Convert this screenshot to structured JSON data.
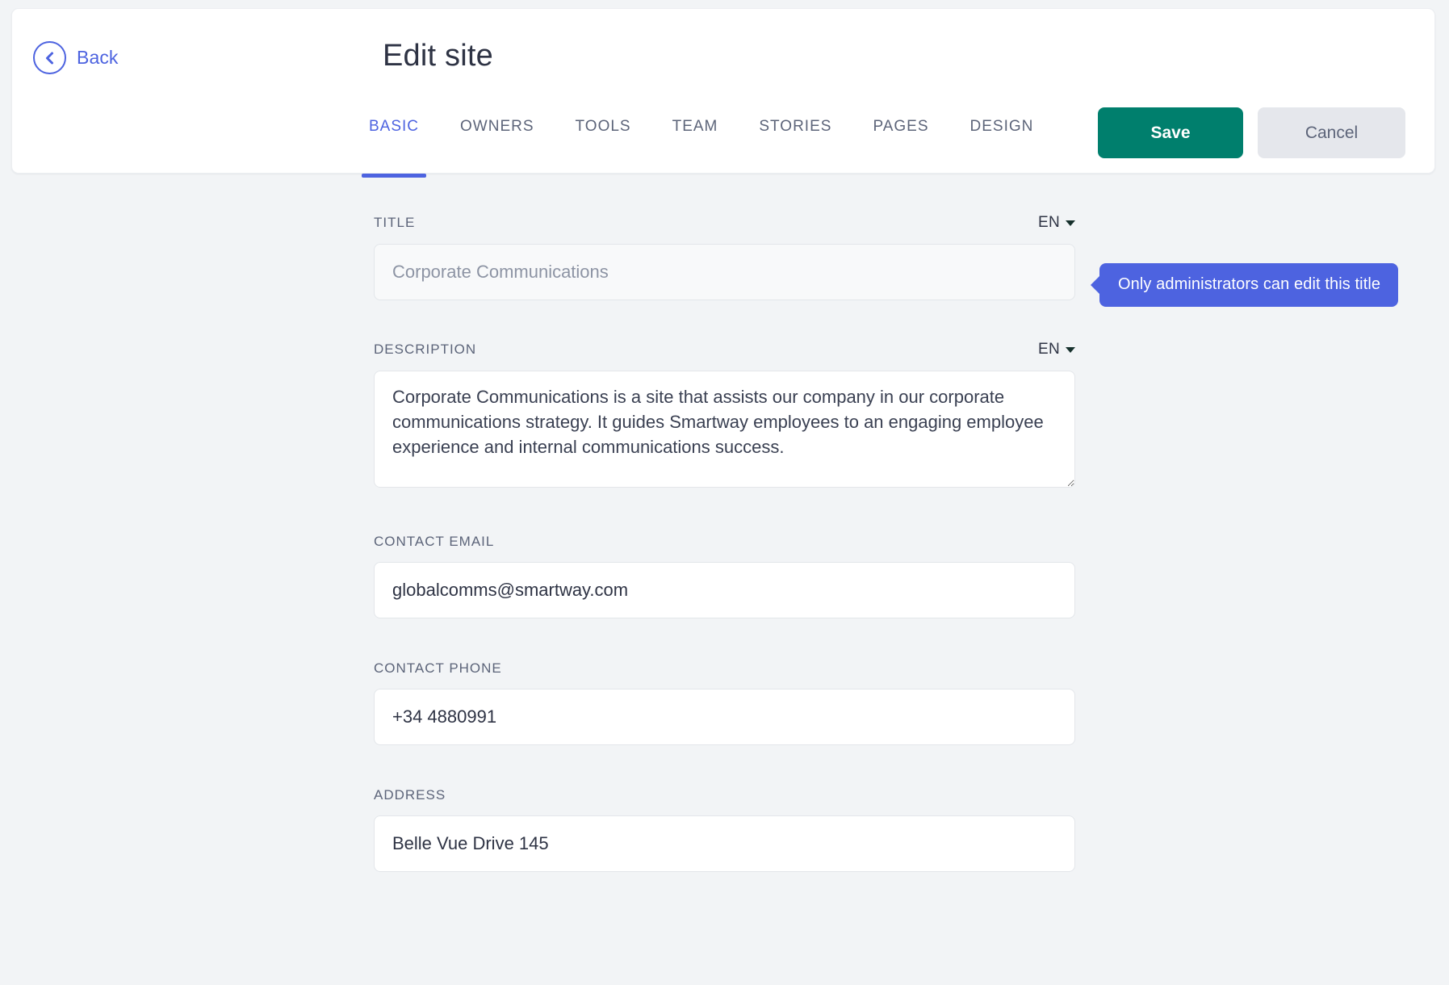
{
  "header": {
    "back_label": "Back",
    "back_icon": "chevron-left-circle-icon",
    "title": "Edit site"
  },
  "tabs": [
    {
      "label": "BASIC",
      "active": true
    },
    {
      "label": "OWNERS",
      "active": false
    },
    {
      "label": "TOOLS",
      "active": false
    },
    {
      "label": "TEAM",
      "active": false
    },
    {
      "label": "STORIES",
      "active": false
    },
    {
      "label": "PAGES",
      "active": false
    },
    {
      "label": "DESIGN",
      "active": false
    }
  ],
  "actions": {
    "save_label": "Save",
    "cancel_label": "Cancel"
  },
  "form": {
    "title": {
      "label": "TITLE",
      "lang": "EN",
      "placeholder": "Corporate Communications",
      "value": "",
      "disabled": true
    },
    "description": {
      "label": "DESCRIPTION",
      "lang": "EN",
      "value": "Corporate Communications is a site that assists our company in our corporate communications strategy. It guides Smartway employees to an engaging employee experience and internal communications success."
    },
    "contact_email": {
      "label": "CONTACT EMAIL",
      "value": "globalcomms@smartway.com"
    },
    "contact_phone": {
      "label": "CONTACT PHONE",
      "value": "+34 4880991"
    },
    "address": {
      "label": "ADDRESS",
      "value": "Belle Vue Drive 145"
    }
  },
  "tooltip": {
    "text": "Only administrators can edit this title"
  },
  "colors": {
    "accent_blue": "#4d63e0",
    "save_green": "#007f6d",
    "cancel_grey": "#e5e7ec",
    "page_background": "#f2f4f6",
    "text_dark": "#2e3344",
    "text_muted": "#5c6479"
  }
}
